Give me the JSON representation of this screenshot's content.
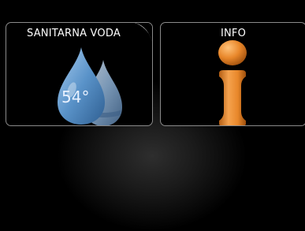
{
  "tiles": {
    "hot_water": {
      "title": "SANITARNA VODA",
      "temperature": "54°",
      "icon": "water-drop-icon"
    },
    "info": {
      "title": "INFO",
      "icon": "info-icon"
    }
  },
  "colors": {
    "drop_blue": "#5a93c9",
    "info_orange": "#e8872a",
    "tile_border": "#8a8a8a",
    "background": "#000000"
  }
}
